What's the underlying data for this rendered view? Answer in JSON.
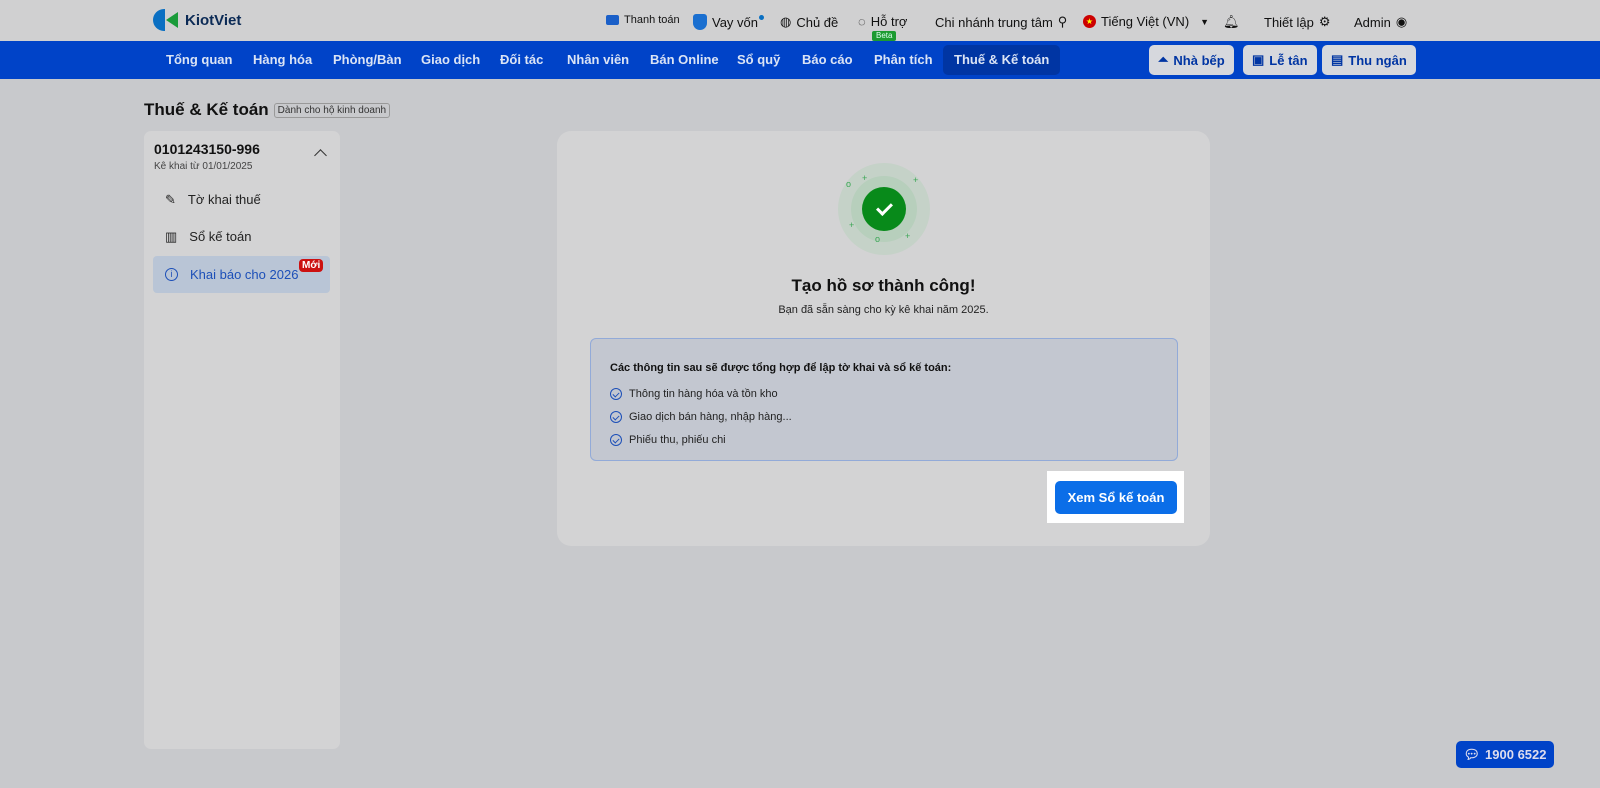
{
  "brand": "KiotViet",
  "topbar": {
    "payment": "Thanh toán",
    "loan": "Vay vốn",
    "theme": "Chủ đề",
    "support": "Hỗ trợ",
    "beta": "Beta",
    "branch": "Chi nhánh trung tâm",
    "language": "Tiếng Việt (VN)",
    "settings": "Thiết lập",
    "user": "Admin"
  },
  "nav": {
    "items": [
      "Tổng quan",
      "Hàng hóa",
      "Phòng/Bàn",
      "Giao dịch",
      "Đối tác",
      "Nhân viên",
      "Bán Online",
      "Sổ quỹ",
      "Báo cáo",
      "Phân tích",
      "Thuế & Kế toán"
    ],
    "active": "Thuế & Kế toán",
    "buttons": [
      "Nhà bếp",
      "Lễ tân",
      "Thu ngân"
    ]
  },
  "page": {
    "title": "Thuế & Kế toán",
    "tag": "Dành cho hộ kinh doanh"
  },
  "sidebar": {
    "tax_id": "0101243150-996",
    "since": "Kê khai từ 01/01/2025",
    "items": [
      {
        "label": "Tờ khai thuế",
        "icon": "document-edit-icon"
      },
      {
        "label": "Sổ kế toán",
        "icon": "ledger-icon"
      },
      {
        "label": "Khai báo cho 2026",
        "icon": "info-icon",
        "badge": "Mới"
      }
    ]
  },
  "card": {
    "title": "Tạo hồ sơ thành công!",
    "message": "Bạn đã sẵn sàng cho kỳ kê khai năm 2025.",
    "info_heading": "Các thông tin sau sẽ được tổng hợp để lập tờ khai và sổ kế toán:",
    "info_items": [
      "Thông tin hàng hóa và tồn kho",
      "Giao dịch bán hàng, nhập hàng...",
      "Phiếu thu, phiếu chi"
    ],
    "cta": "Xem Sổ kế toán"
  },
  "hotline": "1900 6522",
  "colors": {
    "nav": "#0043c8",
    "cta": "#0b6ee8",
    "success": "#088a1a",
    "badge": "#cc1111"
  }
}
